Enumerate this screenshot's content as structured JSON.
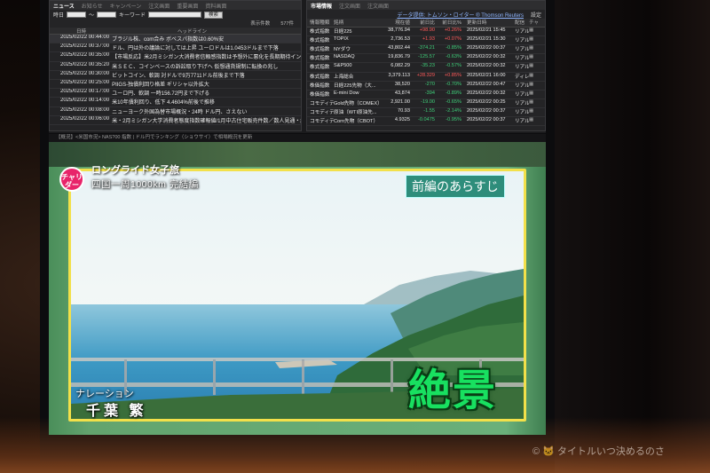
{
  "news_panel": {
    "title": "ニュース",
    "tabs": [
      "お知らせ",
      "キャンペーン",
      "注文画面",
      "重要画面",
      "資料画面"
    ],
    "date_label": "時日",
    "keyword_label": "キーワード",
    "search_button": "検索",
    "count_label": "表示件数",
    "count_value": "577件",
    "col_date": "日時",
    "col_headline": "ヘッドライン",
    "rows": [
      {
        "time": "2025/02/22 00:44:00",
        "headline": "ブラジル株、com合み ボベスパ指数は0.60%安"
      },
      {
        "time": "2025/02/22 00:37:00",
        "headline": "ドル、円は外の議論に対しては上昇 ユーロドルは1.0453ドルまで下落"
      },
      {
        "time": "2025/02/22 00:35:00",
        "headline": "【市場反応】米2月ミシガン大消費者信頼感指数は予想外に悪化を長期期待インフレ率19"
      },
      {
        "time": "2025/02/22 00:35:20",
        "headline": "米ＳＥＣ、コインベースの訴訟取り下げへ 仮想通貨規制に転換の兆し"
      },
      {
        "time": "2025/02/22 00:30:00",
        "headline": "ビットコイン、軟調 対ドルで9万7711ドル前後まで下落"
      },
      {
        "time": "2025/02/22 00:25:00",
        "headline": "PIIGS-独債利回り格差 ギリシャ以外拡大"
      },
      {
        "time": "2025/02/22 00:17:00",
        "headline": "ユーロ円、軟調 一時156.72円まで下げる"
      },
      {
        "time": "2025/02/22 00:14:00",
        "headline": "米10年債利回り、低下 4.4604%前後で推移"
      },
      {
        "time": "2025/02/22 00:08:00",
        "headline": "ニューヨーク外国為替市場概況・24時 ドル円、さえない"
      },
      {
        "time": "2025/02/22 00:06:00",
        "headline": "米・2月ミシガン大学消費者態度指数確報値/1月中古住宅販売件数／数人見通・経済"
      }
    ]
  },
  "market_panel": {
    "title": "市場情報",
    "tabs": [
      "注文画面",
      "注文画面"
    ],
    "source": "データ提供: トムソン・ロイター ® Thomson Reuters",
    "settings": "設定",
    "headers": [
      "情報種類",
      "銘柄",
      "現在値",
      "前日比",
      "前日比%",
      "更新日時",
      "配信",
      "チャート"
    ],
    "rows": [
      {
        "type": "株式指数",
        "name": "日経225",
        "price": "38,776.94",
        "chg": "+98.90",
        "pct": "+0.26%",
        "time": "2025/02/21 15:45",
        "src": "リアル",
        "dir": "up"
      },
      {
        "type": "株式指数",
        "name": "TOPIX",
        "price": "2,736.53",
        "chg": "+1.93",
        "pct": "+0.07%",
        "time": "2025/02/21 15:30",
        "src": "リアル",
        "dir": "up"
      },
      {
        "type": "株式指数",
        "name": "NYダウ",
        "price": "43,802.44",
        "chg": "-374.21",
        "pct": "-0.85%",
        "time": "2025/02/22 00:37",
        "src": "リアル",
        "dir": "down"
      },
      {
        "type": "株式指数",
        "name": "NASDAQ",
        "price": "19,836.79",
        "chg": "-125.57",
        "pct": "-0.63%",
        "time": "2025/02/22 00:32",
        "src": "リアル",
        "dir": "down"
      },
      {
        "type": "株式指数",
        "name": "S&P500",
        "price": "6,082.29",
        "chg": "-35.23",
        "pct": "-0.57%",
        "time": "2025/02/22 00:32",
        "src": "リアル",
        "dir": "down"
      },
      {
        "type": "株式指数",
        "name": "上海総合",
        "price": "3,379.113",
        "chg": "+28.329",
        "pct": "+0.85%",
        "time": "2025/02/21 16:00",
        "src": "ディレイ",
        "dir": "up"
      },
      {
        "type": "株価指数",
        "name": "日経225先物（大...",
        "price": "38,520",
        "chg": "-270",
        "pct": "-0.70%",
        "time": "2025/02/22 00:47",
        "src": "リアル",
        "dir": "down"
      },
      {
        "type": "株価指数",
        "name": "E-mini Dow",
        "price": "43,874",
        "chg": "-394",
        "pct": "-0.89%",
        "time": "2025/02/22 00:32",
        "src": "リアル",
        "dir": "down"
      },
      {
        "type": "コモディティ",
        "name": "Gold先物（COMEX）",
        "price": "2,921.00",
        "chg": "-19.00",
        "pct": "-0.65%",
        "time": "2025/02/22 00:25",
        "src": "リアル",
        "dir": "down"
      },
      {
        "type": "コモディティ",
        "name": "原油（WTI原油先...",
        "price": "70.93",
        "chg": "-1.55",
        "pct": "-2.14%",
        "time": "2025/02/22 00:37",
        "src": "リアル",
        "dir": "down"
      },
      {
        "type": "コモディティ",
        "name": "Corn先物（CBOT）",
        "price": "4.9325",
        "chg": "-0.0475",
        "pct": "-0.95%",
        "time": "2025/02/22 00:37",
        "src": "リアル",
        "dir": "down"
      }
    ]
  },
  "ticker": "【概況】<米国市況> NAS?00 指数 | ドル円でランキング（ショウサイ）で相場概況を更新",
  "tv": {
    "logo": "チャリダー",
    "program_title": "ロングライド女子旅",
    "program_subtitle": "四国一周1000km 完結編",
    "recap_label": "前編のあらすじ",
    "narration_label": "ナレーション",
    "narrator": "千葉 繁",
    "caption": "絶景"
  },
  "watermark": "© 🐱 タイトルいつ決めるのさ",
  "colors": {
    "up": "#ff5a5a",
    "down": "#3fd07a",
    "caption": "#18e060",
    "frame": "#f2e04a"
  }
}
